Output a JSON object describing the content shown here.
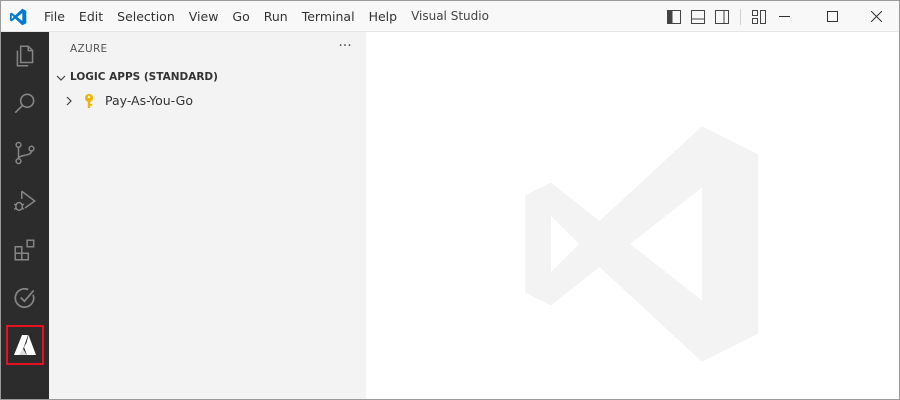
{
  "window": {
    "title": "Visual Studio"
  },
  "menu": [
    {
      "name": "menu-file",
      "label": "File"
    },
    {
      "name": "menu-edit",
      "label": "Edit"
    },
    {
      "name": "menu-selection",
      "label": "Selection"
    },
    {
      "name": "menu-view",
      "label": "View"
    },
    {
      "name": "menu-go",
      "label": "Go"
    },
    {
      "name": "menu-run",
      "label": "Run"
    },
    {
      "name": "menu-terminal",
      "label": "Terminal"
    },
    {
      "name": "menu-help",
      "label": "Help"
    }
  ],
  "layout_controls": [
    "toggle-primary-sidebar-icon",
    "toggle-panel-icon",
    "toggle-secondary-sidebar-icon",
    "customize-layout-icon"
  ],
  "window_controls": [
    "minimize-icon",
    "maximize-icon",
    "close-icon"
  ],
  "activity_bar": {
    "items": [
      "explorer-icon",
      "search-icon",
      "source-control-icon",
      "run-debug-icon",
      "extensions-icon",
      "testing-icon",
      "azure-icon"
    ],
    "selected": "azure-icon"
  },
  "sidebar": {
    "header": "AZURE",
    "more_label": "···",
    "section": {
      "label": "LOGIC APPS (STANDARD)",
      "expanded": true
    },
    "tree": [
      {
        "label": "Pay-As-You-Go",
        "icon": "key-icon",
        "expanded": false
      }
    ]
  },
  "colors": {
    "activity_bar": "#2c2c2c",
    "sidebar": "#f3f3f3",
    "titlebar": "#f8f8f8",
    "selected_outline": "#e81123",
    "vscode_blue": "#0078d4",
    "key": "#f0b400"
  }
}
